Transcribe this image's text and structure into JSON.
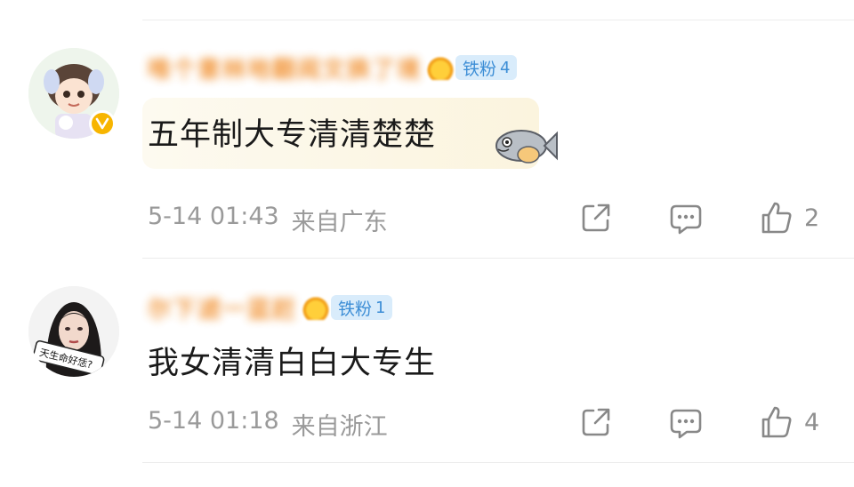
{
  "comments": [
    {
      "username": "唯个意林地翻阅文换了境",
      "fan_badge": {
        "label": "铁粉",
        "level": "4"
      },
      "text": "五年制大专清清楚楚",
      "date": "5-14 01:43",
      "location": "来自广东",
      "likes": "2",
      "verified": true
    },
    {
      "username": "尔下滤一蓝赶",
      "fan_badge": {
        "label": "铁粉",
        "level": "1"
      },
      "text": "我女清清白白大专生",
      "date": "5-14 01:18",
      "location": "来自浙江",
      "likes": "4",
      "avatar_caption": "天生命好恁?"
    }
  ],
  "colors": {
    "username": "#f08a24",
    "badge_bg": "#d9ecfb",
    "badge_text": "#3d8ed6",
    "meta_text": "#9a9a9a"
  },
  "icons": [
    "share-icon",
    "comment-icon",
    "thumbs-up-icon",
    "fish-sticker-icon",
    "verified-badge-icon",
    "fan-crown-icon"
  ]
}
